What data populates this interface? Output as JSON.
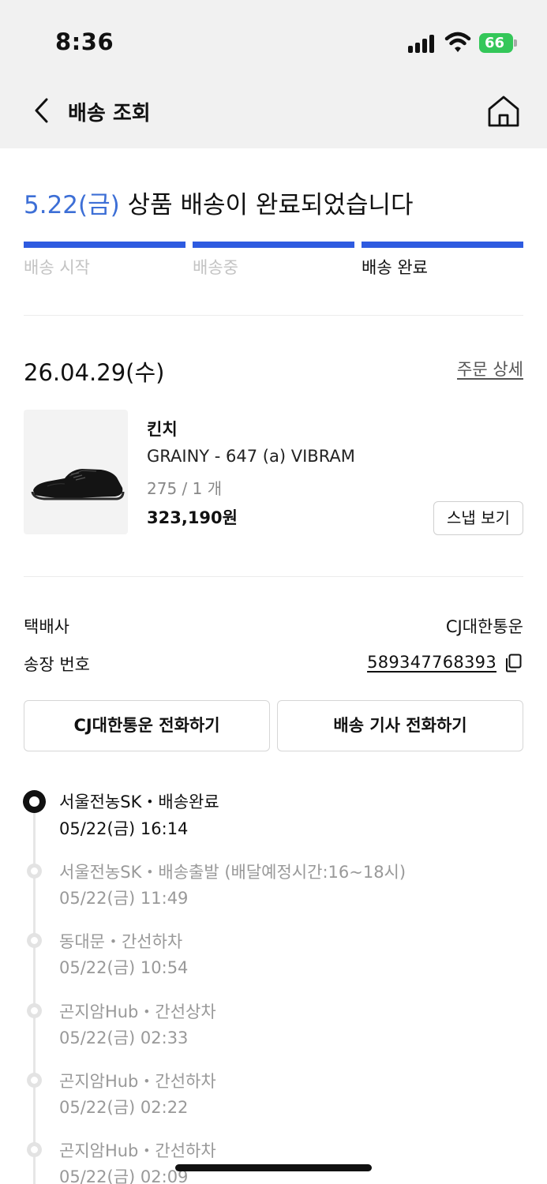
{
  "status_bar": {
    "time": "8:36",
    "battery": "66"
  },
  "nav": {
    "title": "배송 조회"
  },
  "delivery": {
    "date": "5.22(금)",
    "message": "상품 배송이 완료되었습니다",
    "steps": [
      "배송 시작",
      "배송중",
      "배송 완료"
    ],
    "active_step": 2,
    "progress": 1.0
  },
  "order": {
    "date": "26.04.29(수)",
    "detail_link": "주문 상세",
    "brand": "킨치",
    "product_name": "GRAINY - 647 (a) VIBRAM",
    "option": "275 / 1 개",
    "price": "323,190원",
    "snap_button": "스냅 보기"
  },
  "shipping": {
    "courier_label": "택배사",
    "courier_value": "CJ대한통운",
    "tracking_label": "송장 번호",
    "tracking_number": "589347768393",
    "call_courier_button": "CJ대한통운 전화하기",
    "call_driver_button": "배송 기사 전화하기"
  },
  "timeline": [
    {
      "title": "서울전농SK・배송완료",
      "time": "05/22(금) 16:14",
      "current": true
    },
    {
      "title": "서울전농SK・배송출발 (배달예정시간:16~18시)",
      "time": "05/22(금) 11:49",
      "current": false
    },
    {
      "title": "동대문・간선하차",
      "time": "05/22(금) 10:54",
      "current": false
    },
    {
      "title": "곤지암Hub・간선상차",
      "time": "05/22(금) 02:33",
      "current": false
    },
    {
      "title": "곤지암Hub・간선하차",
      "time": "05/22(금) 02:22",
      "current": false
    },
    {
      "title": "곤지암Hub・간선하차",
      "time": "05/22(금) 02:09",
      "current": false
    }
  ],
  "colors": {
    "accent": "#2e5be0",
    "date_blue": "#3d6fd6",
    "battery_green": "#34c759"
  },
  "icons": [
    "back-arrow-icon",
    "home-icon",
    "copy-icon",
    "signal-icon",
    "wifi-icon",
    "battery-icon"
  ]
}
